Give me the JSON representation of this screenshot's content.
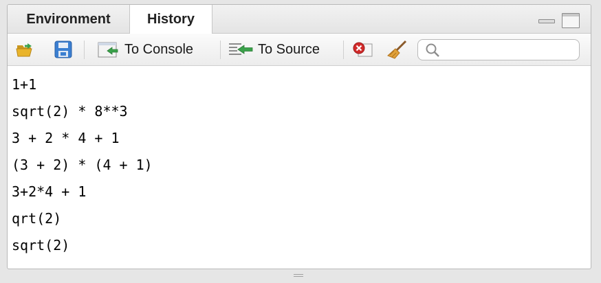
{
  "tabs": [
    {
      "label": "Environment",
      "active": false
    },
    {
      "label": "History",
      "active": true
    }
  ],
  "toolbar": {
    "load_icon": "folder-open-icon",
    "save_icon": "save-icon",
    "to_console_label": "To Console",
    "to_source_label": "To Source",
    "remove_icon": "remove-entry-icon",
    "clear_icon": "broom-icon",
    "search_placeholder": ""
  },
  "history": {
    "entries": [
      "1+1",
      "sqrt(2) * 8**3",
      "3 + 2 * 4 + 1",
      "(3 + 2) * (4 + 1)",
      "3+2*4 + 1",
      "qrt(2)",
      "sqrt(2)"
    ]
  },
  "colors": {
    "accent_green": "#3aa14a",
    "remove_red": "#d12b2b",
    "folder_yellow": "#e9b42b",
    "save_blue": "#3b7fd1"
  }
}
